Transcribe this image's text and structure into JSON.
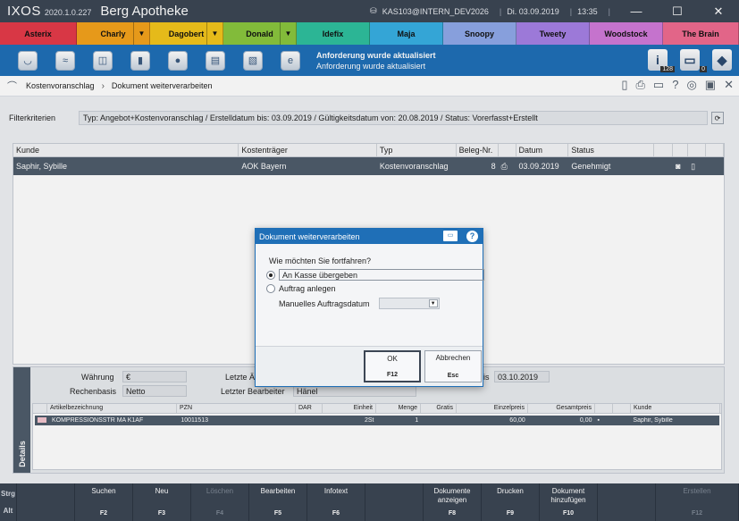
{
  "app": {
    "name": "IXOS",
    "version": "2020.1.0.227",
    "pharmacy": "Berg Apotheke",
    "workstation": "KAS103@INTERN_DEV2026",
    "date": "Di. 03.09.2019",
    "time": "13:35"
  },
  "window_controls": {
    "minimize": "—",
    "maximize": "☐",
    "close": "✕"
  },
  "users": [
    {
      "name": "Asterix",
      "color": "#e43a49",
      "width": 86,
      "dropdown": false
    },
    {
      "name": "Charly",
      "color": "#f3a21c",
      "width": 82,
      "dropdown": true
    },
    {
      "name": "Dagobert",
      "color": "#f2c51c",
      "width": 82,
      "dropdown": true
    },
    {
      "name": "Donald",
      "color": "#89c63e",
      "width": 82,
      "dropdown": true
    },
    {
      "name": "Idefix",
      "color": "#2fbf9d",
      "width": 82,
      "dropdown": false
    },
    {
      "name": "Maja",
      "color": "#37aee2",
      "width": 82,
      "dropdown": false
    },
    {
      "name": "Snoopy",
      "color": "#8fa8e8",
      "width": 82,
      "dropdown": false
    },
    {
      "name": "Tweety",
      "color": "#a580e4",
      "width": 82,
      "dropdown": false
    },
    {
      "name": "Woodstock",
      "color": "#d07ad8",
      "width": 82,
      "dropdown": false
    },
    {
      "name": "The Brain",
      "color": "#ef6b90",
      "width": 85,
      "dropdown": false
    }
  ],
  "toolbar_icons": [
    "mortar-icon",
    "handshake-icon",
    "basket-icon",
    "bottle-icon",
    "pills-icon",
    "documents-icon",
    "copy-icon",
    "browser-icon"
  ],
  "notification": {
    "title": "Anforderung wurde aktualisiert",
    "message": "Anforderung wurde aktualisiert"
  },
  "badges": {
    "info": "128",
    "clipboard": "0"
  },
  "breadcrumb": {
    "root": "Kostenvoranschlag",
    "current": "Dokument weiterverarbeiten"
  },
  "filter": {
    "label": "Filterkriterien",
    "value": "Typ: Angebot+Kostenvoranschlag / Erstelldatum bis: 03.09.2019 / Gültigkeitsdatum von: 20.08.2019 / Status: Vorerfasst+Erstellt"
  },
  "grid": {
    "headers": [
      "Kunde",
      "Kostenträger",
      "Typ",
      "Beleg-Nr.",
      "",
      "Datum",
      "Status",
      "",
      "",
      "",
      ""
    ],
    "rows": [
      {
        "kunde": "Saphir, Sybille",
        "kostentraeger": "AOK Bayern",
        "typ": "Kostenvoranschlag",
        "beleg": "8",
        "datum": "03.09.2019",
        "status": "Genehmigt"
      }
    ]
  },
  "details": {
    "tab": "Details",
    "waehrung_label": "Währung",
    "waehrung": "€",
    "rechenbasis_label": "Rechenbasis",
    "rechenbasis": "Netto",
    "letzte_label": "Letzte Ä",
    "letzte_bearbeiter_label": "Letzter Bearbeiter",
    "letzte_bearbeiter": "Hänel",
    "gueltig_suffix": "is",
    "gueltig": "03.10.2019",
    "sub_headers": [
      "",
      "Artikelbezeichnung",
      "PZN",
      "DAR",
      "Einheit",
      "Menge",
      "Gratis",
      "Einzelpreis",
      "Gesamtpreis",
      "",
      "",
      "Kunde"
    ],
    "sub_rows": [
      {
        "artikel": "KOMPRESSIONSSTR MA K1AF",
        "pzn": "10011513",
        "dar": "",
        "einheit": "2St",
        "menge": "1",
        "gratis": "",
        "einzelpreis": "60,00",
        "gesamtpreis": "0,00",
        "kunde": "Saphir, Sybille"
      }
    ]
  },
  "dialog": {
    "title": "Dokument weiterverarbeiten",
    "question": "Wie möchten Sie fortfahren?",
    "option1": "An Kasse übergeben",
    "option2": "Auftrag anlegen",
    "date_label": "Manuelles Auftragsdatum",
    "ok_label": "OK",
    "ok_key": "F12",
    "cancel_label": "Abbrechen",
    "cancel_key": "Esc"
  },
  "fkeys": {
    "mod1": "Strg",
    "mod2": "Alt",
    "keys": [
      {
        "label": "",
        "key": "",
        "disabled": false
      },
      {
        "label": "Suchen",
        "key": "F2",
        "disabled": false
      },
      {
        "label": "Neu",
        "key": "F3",
        "disabled": false
      },
      {
        "label": "Löschen",
        "key": "F4",
        "disabled": true
      },
      {
        "label": "Bearbeiten",
        "key": "F5",
        "disabled": false
      },
      {
        "label": "Infotext",
        "key": "F6",
        "disabled": false
      },
      {
        "label": "",
        "key": "",
        "disabled": false
      },
      {
        "label": "Dokumente anzeigen",
        "key": "F8",
        "disabled": false
      },
      {
        "label": "Drucken",
        "key": "F9",
        "disabled": false
      },
      {
        "label": "Dokument hinzufügen",
        "key": "F10",
        "disabled": false
      },
      {
        "label": "",
        "key": "",
        "disabled": false
      },
      {
        "label": "Erstellen",
        "key": "F12",
        "disabled": true
      }
    ]
  }
}
